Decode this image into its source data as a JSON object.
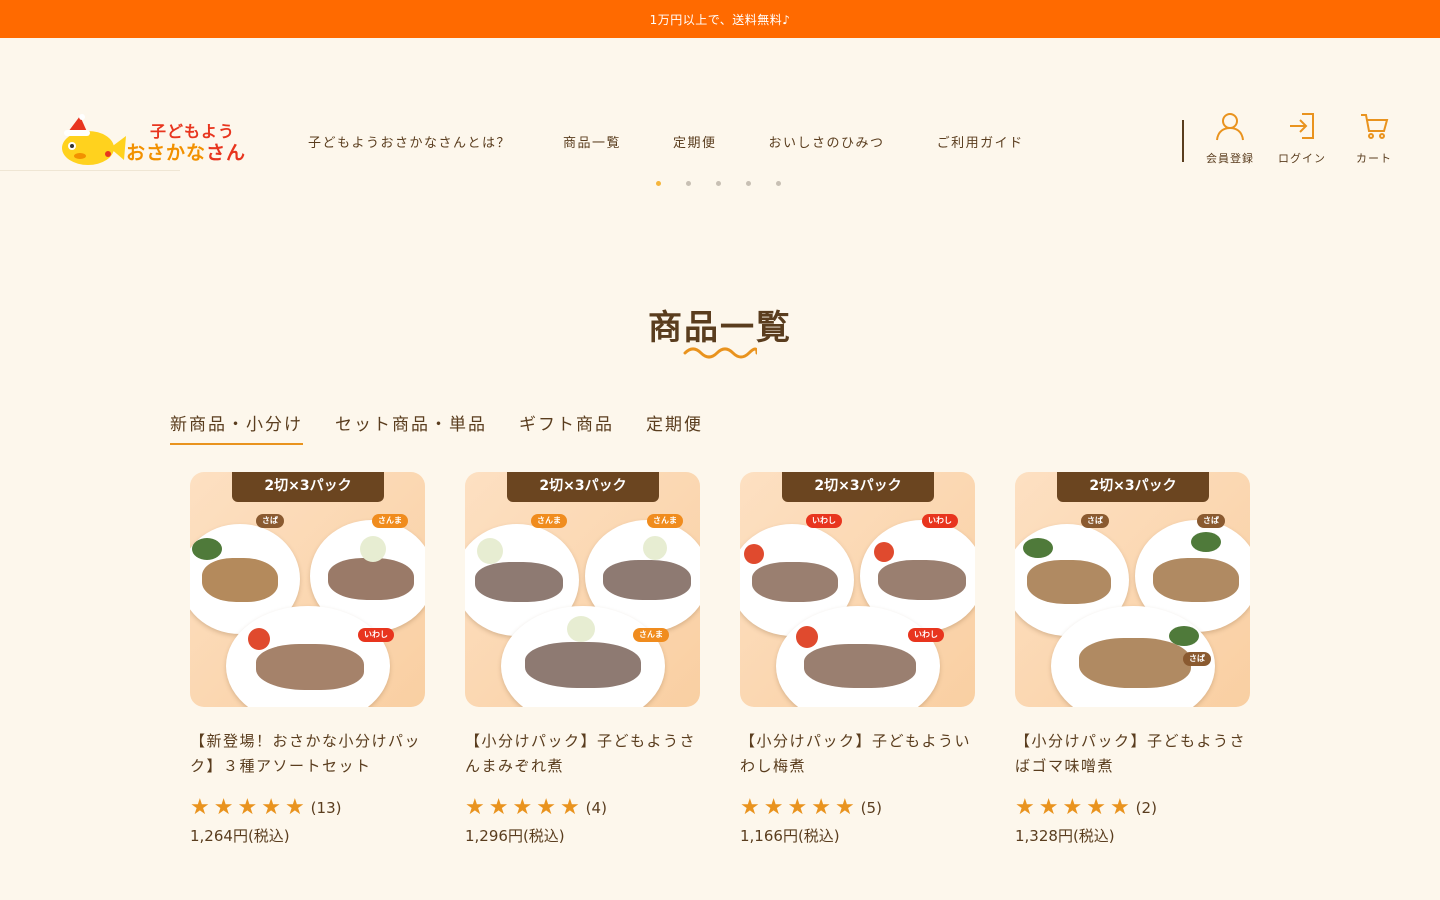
{
  "announcement": "1万円以上で、送料無料♪",
  "logo": {
    "line1": "子どもよう",
    "line2_a": "おさかな",
    "line2_b": "さん"
  },
  "nav": [
    "子どもようおさかなさんとは？",
    "商品一覧",
    "定期便",
    "おいしさのひみつ",
    "ご利用ガイド"
  ],
  "header_icons": {
    "register": "会員登録",
    "login": "ログイン",
    "cart": "カート"
  },
  "section_title": "商品一覧",
  "tabs": [
    "新商品・小分け",
    "セット商品・単品",
    "ギフト商品",
    "定期便"
  ],
  "products": [
    {
      "badge": "2切×3パック",
      "name": "【新登場！おさかな小分けパック】３種アソートセット",
      "rating": 5,
      "count": "(13)",
      "price": "1,264円(税込)",
      "tags": [
        "さば",
        "さんま",
        "いわし"
      ]
    },
    {
      "badge": "2切×3パック",
      "name": "【小分けパック】子どもようさんまみぞれ煮",
      "rating": 5,
      "count": "(4)",
      "price": "1,296円(税込)",
      "tags": [
        "さんま",
        "さんま",
        "さんま"
      ]
    },
    {
      "badge": "2切×3パック",
      "name": "【小分けパック】子どもよういわし梅煮",
      "rating": 5,
      "count": "(5)",
      "price": "1,166円(税込)",
      "tags": [
        "いわし",
        "いわし",
        "いわし"
      ]
    },
    {
      "badge": "2切×3パック",
      "name": "【小分けパック】子どもようさばゴマ味噌煮",
      "rating": 5,
      "count": "(2)",
      "price": "1,328円(税込)",
      "tags": [
        "さば",
        "さば",
        "さば"
      ]
    }
  ],
  "colors": {
    "accent": "#ff6a00",
    "brown": "#5a3d1e",
    "star": "#e9931e",
    "bg": "#fdf7ec"
  }
}
